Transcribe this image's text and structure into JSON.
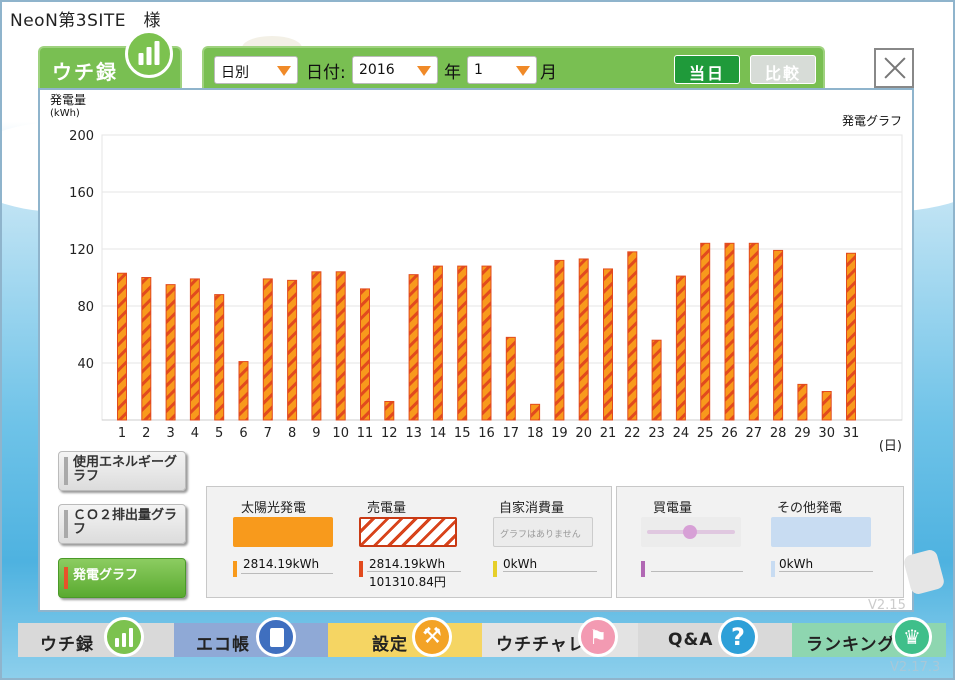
{
  "site": {
    "title": "NeoN第3SITE　様"
  },
  "tab": {
    "label": "ウチ録"
  },
  "toolbar": {
    "period": "日別",
    "date_label": "日付:",
    "year": "2016",
    "year_unit": "年",
    "month": "1",
    "month_unit": "月",
    "today_label": "当日",
    "compare_label": "比較"
  },
  "chart_data": {
    "type": "bar",
    "title": "発電グラフ",
    "ylabel": "発電量",
    "yunit": "(kWh)",
    "xunit": "(日)",
    "ylim": [
      0,
      200
    ],
    "yticks": [
      40,
      80,
      120,
      160,
      200
    ],
    "categories": [
      "1",
      "2",
      "3",
      "4",
      "5",
      "6",
      "7",
      "8",
      "9",
      "10",
      "11",
      "12",
      "13",
      "14",
      "15",
      "16",
      "17",
      "18",
      "19",
      "20",
      "21",
      "22",
      "23",
      "24",
      "25",
      "26",
      "27",
      "28",
      "29",
      "30",
      "31"
    ],
    "values": [
      103,
      100,
      95,
      99,
      88,
      41,
      99,
      98,
      104,
      104,
      92,
      13,
      102,
      108,
      108,
      108,
      58,
      11,
      112,
      113,
      106,
      118,
      56,
      101,
      124,
      124,
      124,
      119,
      25,
      20,
      117
    ],
    "bar_color": "#f89a1c",
    "hatch_color": "#e24a1e",
    "grid": true
  },
  "side": {
    "energy_label": "使用エネルギーグラフ",
    "co2_label": "ＣＯ２排出量グラフ",
    "gen_label": "発電グラフ"
  },
  "summary": {
    "solar": {
      "title": "太陽光発電",
      "value": "2814.19kWh",
      "color": "#f89a1c"
    },
    "sell": {
      "title": "売電量",
      "value": "2814.19kWh",
      "value2": "101310.84円",
      "color": "#e24a1e"
    },
    "self": {
      "title": "自家消費量",
      "note": "グラフはありません",
      "value": "0kWh",
      "color": "#e6cf2a"
    },
    "buy": {
      "title": "買電量",
      "color": "#b168b4"
    },
    "other": {
      "title": "その他発電",
      "value": "0kWh",
      "color": "#c8dcf2"
    }
  },
  "nav": {
    "uchiroku": "ウチ録",
    "ecocho": "エコ帳",
    "settei": "設定",
    "uchichare": "ウチチャレ",
    "qa": "Q&A",
    "ranking": "ランキング"
  },
  "version": {
    "faded": "V2.15",
    "current": "V2.17.3"
  }
}
